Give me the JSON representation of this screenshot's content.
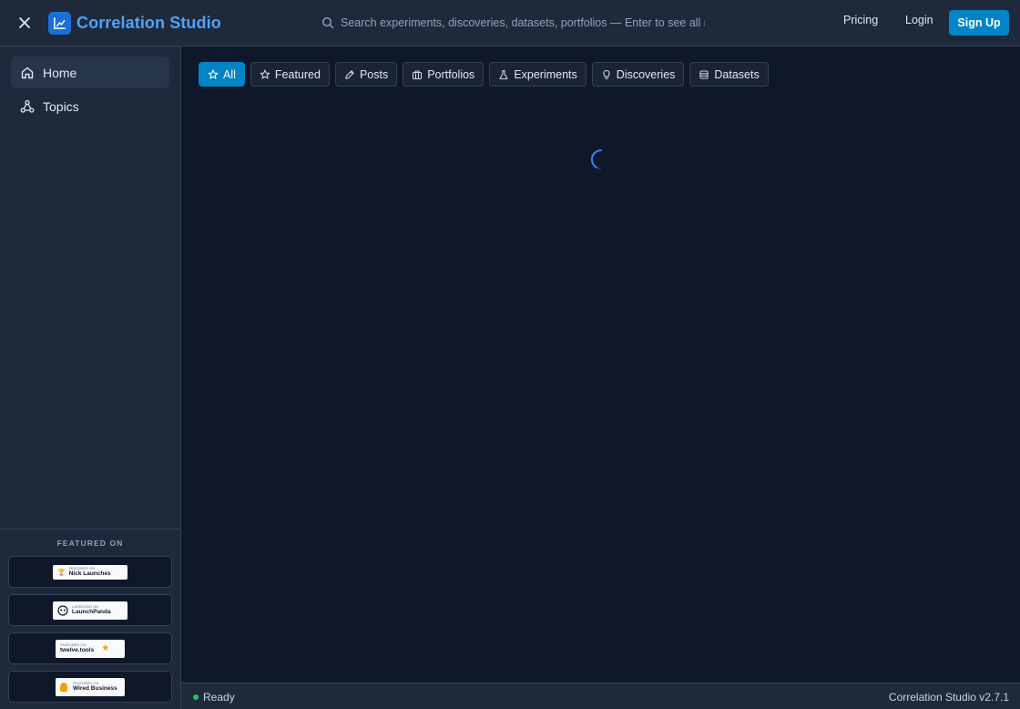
{
  "header": {
    "brand_name": "Correlation Studio",
    "search_placeholder": "Search experiments, discoveries, datasets, portfolios — Enter to see all resu",
    "nav": {
      "pricing": "Pricing",
      "login": "Login",
      "signup": "Sign Up"
    }
  },
  "sidebar": {
    "items": [
      {
        "label": "Home",
        "icon": "home-icon",
        "active": true
      },
      {
        "label": "Topics",
        "icon": "topics-graph-icon",
        "active": false
      }
    ],
    "featured_title": "FEATURED ON",
    "featured_badges": [
      {
        "top": "FEATURED ON",
        "name": "Nick Launches"
      },
      {
        "top": "LAUNCHED ON",
        "name": "LaunchPanda"
      },
      {
        "top": "FEATURED ON",
        "name": "twelve.tools"
      },
      {
        "top": "FEATURED ON",
        "name": "Wired Business"
      }
    ]
  },
  "main": {
    "filters": [
      {
        "label": "All",
        "icon": "star-icon",
        "active": true
      },
      {
        "label": "Featured",
        "icon": "star-icon",
        "active": false
      },
      {
        "label": "Posts",
        "icon": "pen-icon",
        "active": false
      },
      {
        "label": "Portfolios",
        "icon": "portfolio-icon",
        "active": false
      },
      {
        "label": "Experiments",
        "icon": "flask-icon",
        "active": false
      },
      {
        "label": "Discoveries",
        "icon": "lightbulb-icon",
        "active": false
      },
      {
        "label": "Datasets",
        "icon": "database-icon",
        "active": false
      }
    ]
  },
  "status": {
    "text": "Ready",
    "version": "Correlation Studio v2.7.1"
  },
  "colors": {
    "accent": "#0284c7",
    "brand": "#4ea3f7",
    "background": "#0f172a",
    "panel": "#1e293b",
    "ready": "#22c55e"
  }
}
